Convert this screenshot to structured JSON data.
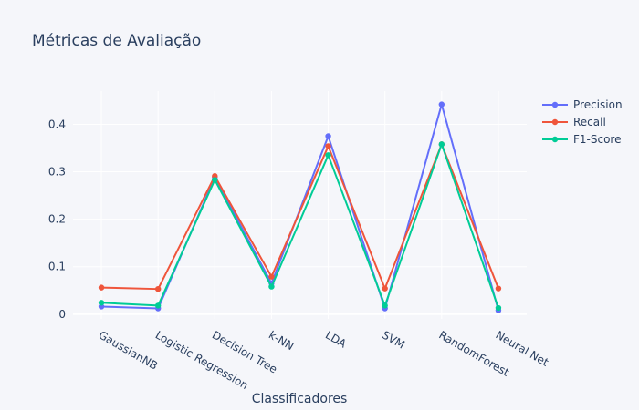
{
  "chart_data": {
    "type": "line",
    "title": "Métricas de Avaliação",
    "xlabel": "Classificadores",
    "ylabel": "",
    "categories": [
      "GaussianNB",
      "Logistic Regression",
      "Decision Tree",
      "k-NN",
      "LDA",
      "SVM",
      "RandomForest",
      "Neural Net"
    ],
    "series": [
      {
        "name": "Precision",
        "color": "#636efa",
        "values": [
          0.016,
          0.012,
          0.288,
          0.065,
          0.375,
          0.012,
          0.442,
          0.008
        ]
      },
      {
        "name": "Recall",
        "color": "#ef553b",
        "values": [
          0.056,
          0.053,
          0.291,
          0.079,
          0.354,
          0.054,
          0.358,
          0.054
        ]
      },
      {
        "name": "F1-Score",
        "color": "#00cc96",
        "values": [
          0.024,
          0.018,
          0.283,
          0.058,
          0.335,
          0.018,
          0.358,
          0.013
        ]
      }
    ],
    "yticks": [
      "0",
      "0.1",
      "0.2",
      "0.3",
      "0.4"
    ],
    "ylim": [
      -0.01,
      0.47
    ],
    "grid": true,
    "legend_position": "top-right"
  }
}
